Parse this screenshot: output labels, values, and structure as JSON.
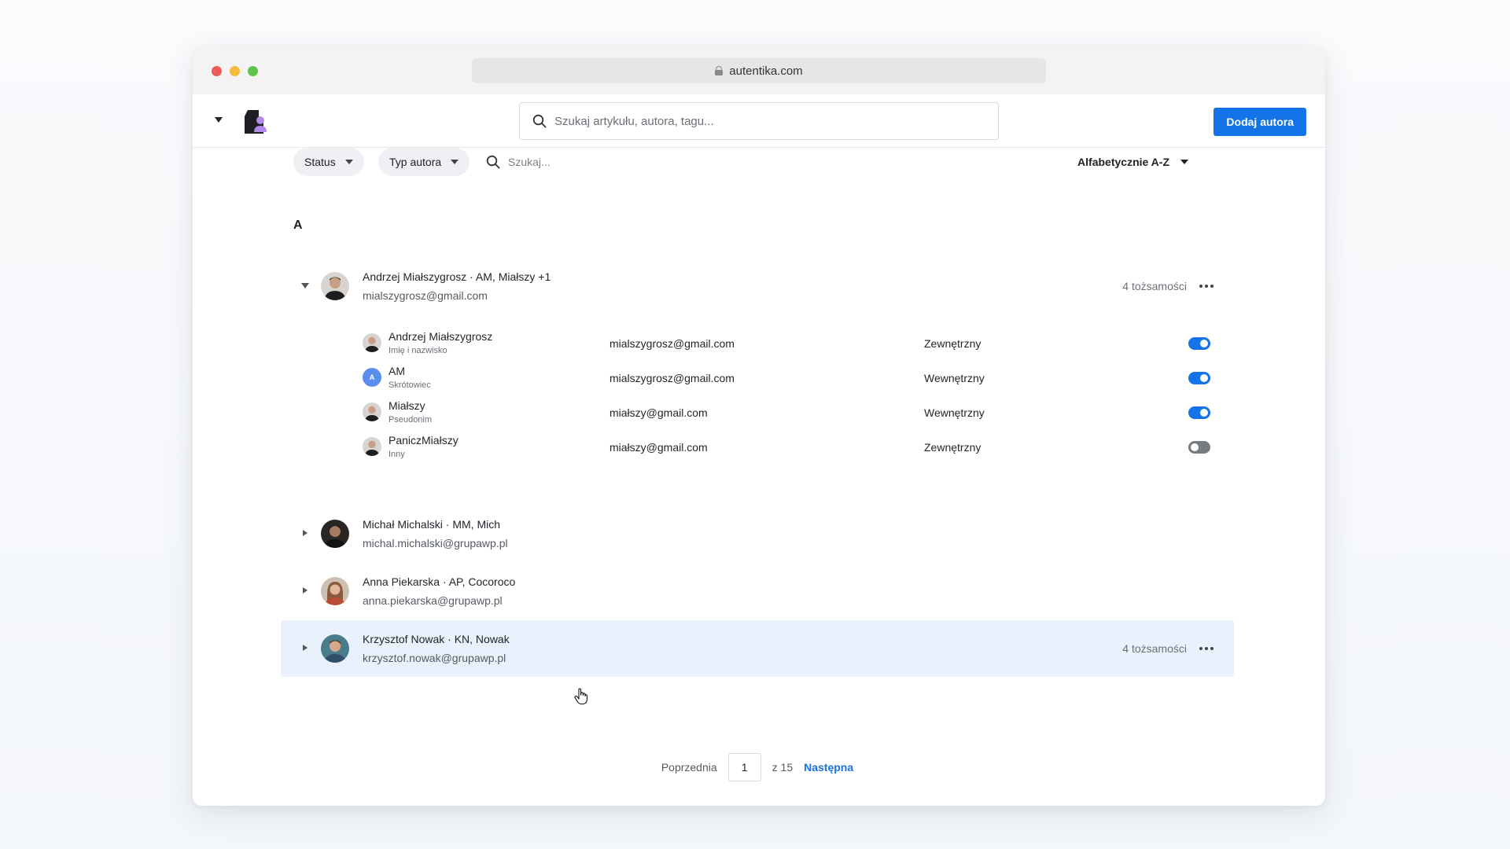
{
  "browser": {
    "url": "autentika.com"
  },
  "header": {
    "search_placeholder": "Szukaj artykułu, autora, tagu...",
    "add_label": "Dodaj autora"
  },
  "filters": {
    "status_label": "Status",
    "type_label": "Typ autora",
    "search_placeholder": "Szukaj...",
    "sort_label": "Alfabetycznie A-Z"
  },
  "group_letter": "A",
  "authors": [
    {
      "name": "Andrzej Miałszygrosz · AM, Miałszy +1",
      "email": "mialszygrosz@gmail.com",
      "count": "4 tożsamości",
      "expanded": true,
      "identities": [
        {
          "name": "Andrzej Miałszygrosz",
          "type": "Imię i nazwisko",
          "email": "mialszygrosz@gmail.com",
          "kind": "Zewnętrzny",
          "enabled": true
        },
        {
          "name": "AM",
          "type": "Skrótowiec",
          "email": "mialszygrosz@gmail.com",
          "kind": "Wewnętrzny",
          "enabled": true,
          "initial": "A"
        },
        {
          "name": "Miałszy",
          "type": "Pseudonim",
          "email": "miałszy@gmail.com",
          "kind": "Wewnętrzny",
          "enabled": true
        },
        {
          "name": "PaniczMiałszy",
          "type": "Inny",
          "email": "miałszy@gmail.com",
          "kind": "Zewnętrzny",
          "enabled": false
        }
      ]
    },
    {
      "name": "Michał Michalski · MM, Mich",
      "email": "michal.michalski@grupawp.pl",
      "expanded": false
    },
    {
      "name": "Anna Piekarska · AP, Cocoroco",
      "email": "anna.piekarska@grupawp.pl",
      "expanded": false
    },
    {
      "name": "Krzysztof Nowak · KN, Nowak",
      "email": "krzysztof.nowak@grupawp.pl",
      "count": "4 tożsamości",
      "expanded": false,
      "highlighted": true
    }
  ],
  "pagination": {
    "prev_label": "Poprzednia",
    "current": "1",
    "of_label": "z 15",
    "next_label": "Następna"
  },
  "colors": {
    "accent": "#1473e6",
    "highlight": "#e8f1fc"
  }
}
